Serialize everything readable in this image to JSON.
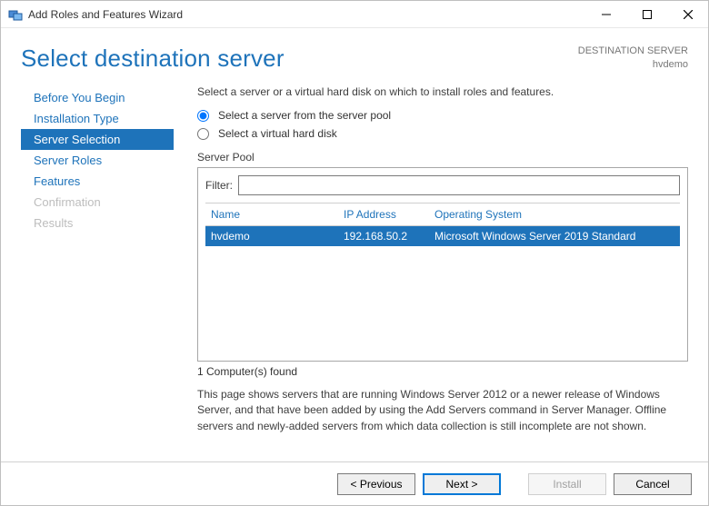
{
  "window": {
    "title": "Add Roles and Features Wizard"
  },
  "header": {
    "page_title": "Select destination server",
    "dest_label": "DESTINATION SERVER",
    "dest_value": "hvdemo"
  },
  "sidenav": {
    "items": [
      {
        "label": "Before You Begin",
        "state": "normal"
      },
      {
        "label": "Installation Type",
        "state": "normal"
      },
      {
        "label": "Server Selection",
        "state": "selected"
      },
      {
        "label": "Server Roles",
        "state": "normal"
      },
      {
        "label": "Features",
        "state": "normal"
      },
      {
        "label": "Confirmation",
        "state": "disabled"
      },
      {
        "label": "Results",
        "state": "disabled"
      }
    ]
  },
  "main": {
    "instruction": "Select a server or a virtual hard disk on which to install roles and features.",
    "radio_pool": "Select a server from the server pool",
    "radio_vhd": "Select a virtual hard disk",
    "section_label": "Server Pool",
    "filter_label": "Filter:",
    "filter_value": "",
    "columns": {
      "name": "Name",
      "ip": "IP Address",
      "os": "Operating System"
    },
    "rows": [
      {
        "name": "hvdemo",
        "ip": "192.168.50.2",
        "os": "Microsoft Windows Server 2019 Standard"
      }
    ],
    "count_text": "1 Computer(s) found",
    "footnote": "This page shows servers that are running Windows Server 2012 or a newer release of Windows Server, and that have been added by using the Add Servers command in Server Manager. Offline servers and newly-added servers from which data collection is still incomplete are not shown."
  },
  "buttons": {
    "previous": "< Previous",
    "next": "Next >",
    "install": "Install",
    "cancel": "Cancel"
  }
}
